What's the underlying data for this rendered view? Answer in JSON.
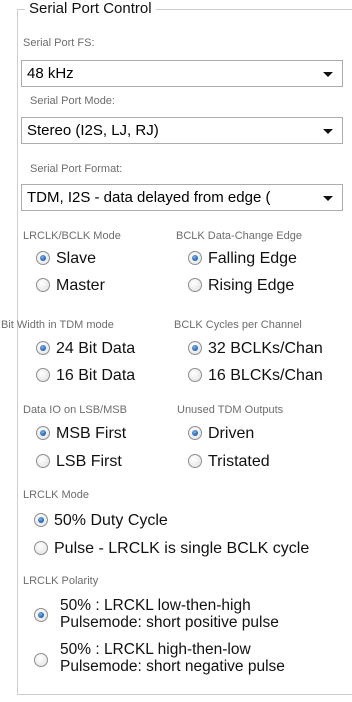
{
  "group_title": "Serial Port Control",
  "serial_port_fs": {
    "label": "Serial Port FS:",
    "value": "48 kHz"
  },
  "serial_port_mode": {
    "label": "Serial Port Mode:",
    "value": "Stereo (I2S, LJ, RJ)"
  },
  "serial_port_format": {
    "label": "Serial Port Format:",
    "value": "TDM, I2S - data delayed from edge ("
  },
  "lrclk_bclk_mode": {
    "label": "LRCLK/BCLK Mode",
    "options": [
      "Slave",
      "Master"
    ],
    "selected": "Slave"
  },
  "bclk_data_change_edge": {
    "label": "BCLK Data-Change Edge",
    "options": [
      "Falling Edge",
      "Rising Edge"
    ],
    "selected": "Falling Edge"
  },
  "bit_width_tdm": {
    "label": "Bit Width in TDM mode",
    "options": [
      "24 Bit Data",
      "16 Bit Data"
    ],
    "selected": "24 Bit Data"
  },
  "bclk_cycles_per_channel": {
    "label": "BCLK Cycles per Channel",
    "options": [
      "32 BCLKs/Chan",
      "16 BLCKs/Chan"
    ],
    "selected": "32 BCLKs/Chan"
  },
  "data_io": {
    "label": "Data IO on LSB/MSB",
    "options": [
      "MSB First",
      "LSB First"
    ],
    "selected": "MSB First"
  },
  "unused_tdm_outputs": {
    "label": "Unused TDM Outputs",
    "options": [
      "Driven",
      "Tristated"
    ],
    "selected": "Driven"
  },
  "lrclk_mode": {
    "label": "LRCLK Mode",
    "options": [
      "50% Duty Cycle",
      "Pulse - LRCLK is single BCLK cycle"
    ],
    "selected": "50% Duty Cycle"
  },
  "lrclk_polarity": {
    "label": "LRCLK Polarity",
    "options": [
      {
        "line1": "50% : LRCKL  low-then-high",
        "line2": "Pulsemode: short positive pulse"
      },
      {
        "line1": "50% : LRCKL  high-then-low",
        "line2": "Pulsemode: short negative pulse"
      }
    ],
    "selected_index": 0
  }
}
